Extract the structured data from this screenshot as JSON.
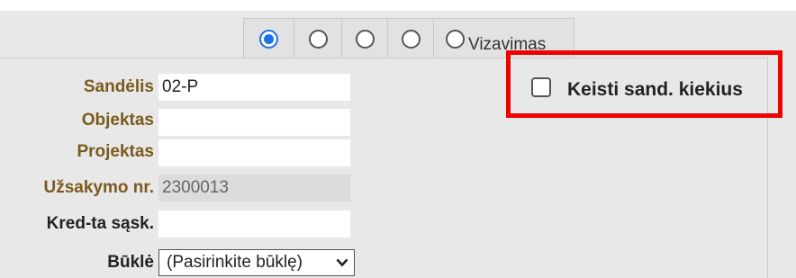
{
  "tabs": {
    "radios": [
      {
        "checked": true
      },
      {
        "checked": false
      },
      {
        "checked": false
      },
      {
        "checked": false
      },
      {
        "checked": false,
        "label": "Vizavimas"
      }
    ],
    "accent": "#1a73e8"
  },
  "form": {
    "sandelis": {
      "label": "Sandėlis",
      "value": "02-P"
    },
    "objektas": {
      "label": "Objektas",
      "value": ""
    },
    "projektas": {
      "label": "Projektas",
      "value": ""
    },
    "uzsakymo": {
      "label": "Užsakymo nr.",
      "value": "2300013"
    },
    "kred": {
      "label": "Kred-ta sąsk.",
      "value": ""
    },
    "bukle": {
      "label": "Būklė",
      "selected": "(Pasirinkite būklę)"
    }
  },
  "options": {
    "keisti_label": "Keisti sand. kiekius",
    "keisti_checked": false,
    "highlight_color": "#ee0000"
  }
}
